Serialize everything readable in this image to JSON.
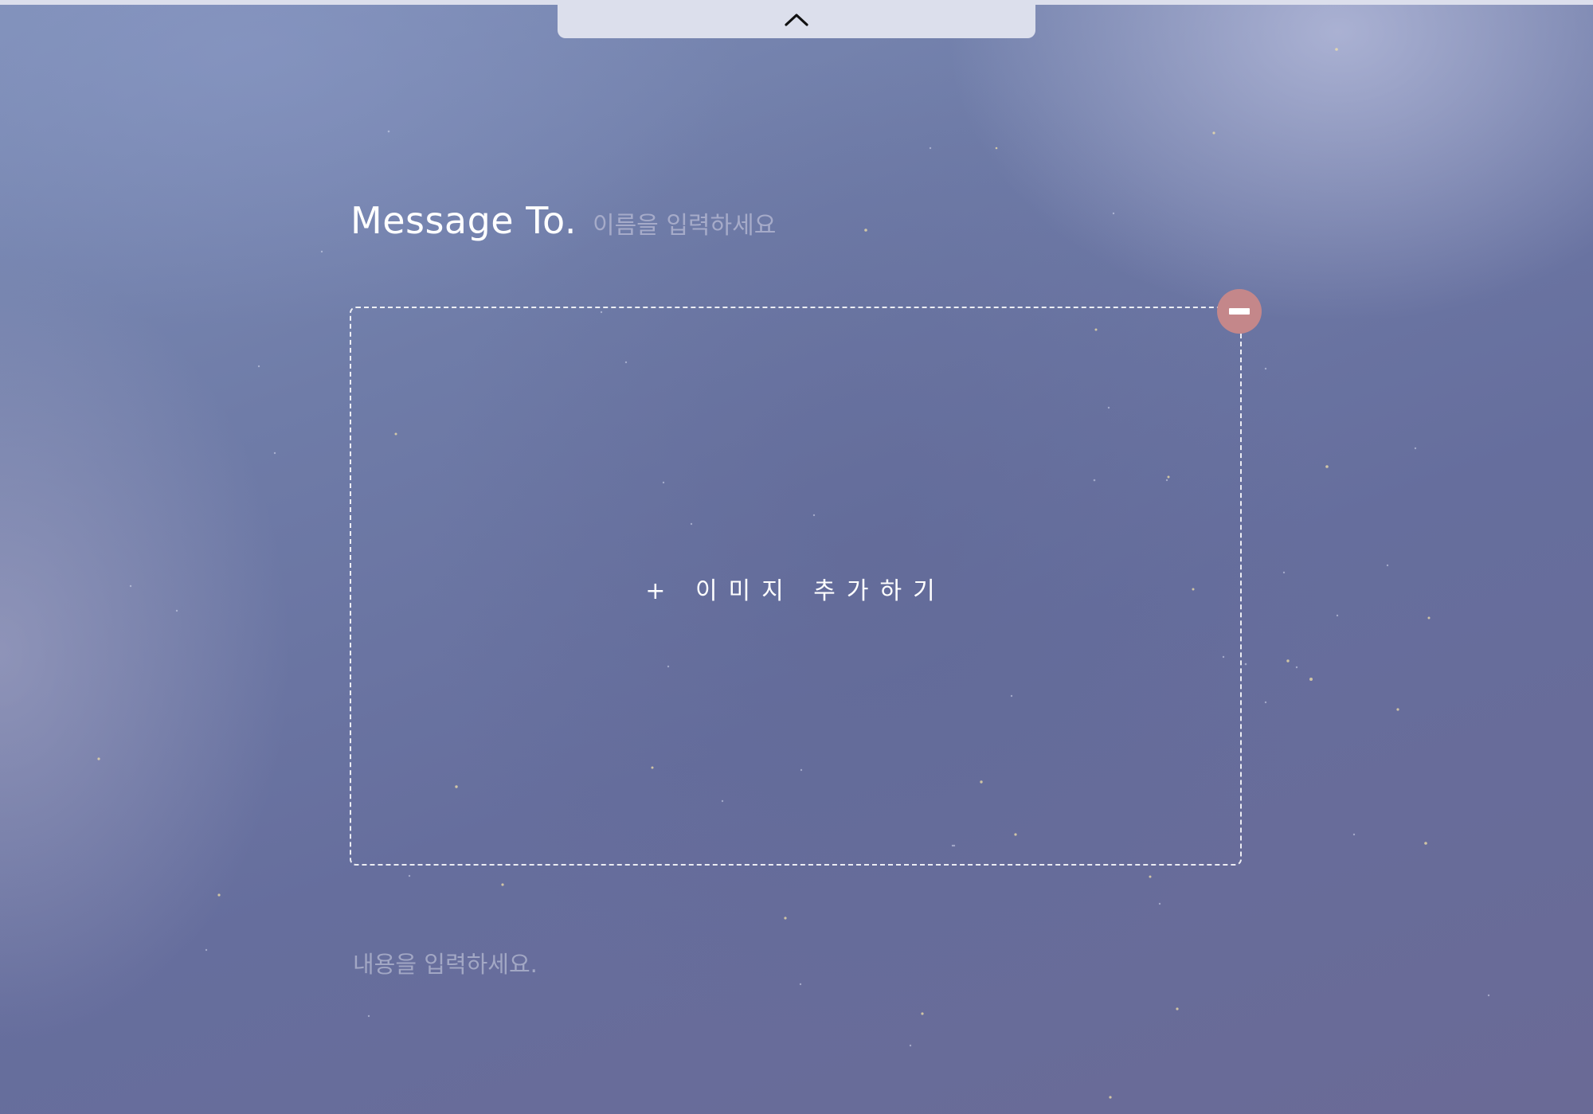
{
  "top_bar": {
    "toggle_icon": "chevron-up-icon",
    "background_color": "#dcdfec"
  },
  "message_header": {
    "title": "Message To.",
    "name_placeholder": "이름을 입력하세요",
    "name_value": ""
  },
  "image_area": {
    "add_label": "+ 이미지 추가하기",
    "remove_icon": "minus-icon",
    "remove_color": "#c4878a"
  },
  "content": {
    "placeholder": "내용을 입력하세요.",
    "value": ""
  }
}
